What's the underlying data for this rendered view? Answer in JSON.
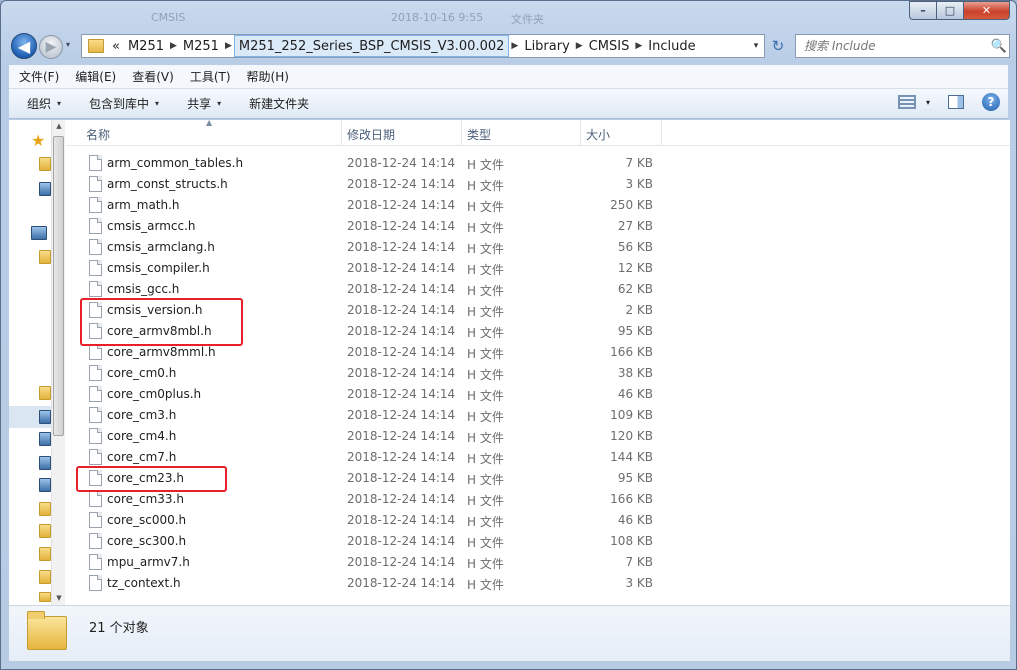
{
  "window": {
    "ghost_title_parts": [
      "CMSIS",
      "2018-10-16 9:55",
      "文件夹"
    ],
    "caption": {
      "minimize": "–",
      "maximize": "□",
      "close": "✕"
    }
  },
  "nav": {
    "back_glyph": "◀",
    "forward_glyph": "▶",
    "history_glyph": "▾"
  },
  "address": {
    "overflow": "«",
    "crumbs": [
      "M251",
      "M251",
      "M251_252_Series_BSP_CMSIS_V3.00.002",
      "Library",
      "CMSIS",
      "Include"
    ],
    "separator": "▶",
    "dropdown": "▾"
  },
  "refresh_glyph": "↻",
  "search": {
    "placeholder": "搜索 Include",
    "icon": "search-icon",
    "glyph": "🔍"
  },
  "menubar": {
    "items": [
      "文件(F)",
      "编辑(E)",
      "查看(V)",
      "工具(T)",
      "帮助(H)"
    ]
  },
  "cmdbar": {
    "organize": "组织",
    "include_library": "包含到库中",
    "share": "共享",
    "new_folder": "新建文件夹",
    "dropdown": "▾",
    "help": "?"
  },
  "columns": {
    "name": "名称",
    "date": "修改日期",
    "type": "类型",
    "size": "大小",
    "sort_indicator": "▲"
  },
  "files": [
    {
      "name": "arm_common_tables.h",
      "date": "2018-12-24 14:14",
      "type": "H 文件",
      "size": "7 KB"
    },
    {
      "name": "arm_const_structs.h",
      "date": "2018-12-24 14:14",
      "type": "H 文件",
      "size": "3 KB"
    },
    {
      "name": "arm_math.h",
      "date": "2018-12-24 14:14",
      "type": "H 文件",
      "size": "250 KB"
    },
    {
      "name": "cmsis_armcc.h",
      "date": "2018-12-24 14:14",
      "type": "H 文件",
      "size": "27 KB"
    },
    {
      "name": "cmsis_armclang.h",
      "date": "2018-12-24 14:14",
      "type": "H 文件",
      "size": "56 KB"
    },
    {
      "name": "cmsis_compiler.h",
      "date": "2018-12-24 14:14",
      "type": "H 文件",
      "size": "12 KB"
    },
    {
      "name": "cmsis_gcc.h",
      "date": "2018-12-24 14:14",
      "type": "H 文件",
      "size": "62 KB"
    },
    {
      "name": "cmsis_version.h",
      "date": "2018-12-24 14:14",
      "type": "H 文件",
      "size": "2 KB"
    },
    {
      "name": "core_armv8mbl.h",
      "date": "2018-12-24 14:14",
      "type": "H 文件",
      "size": "95 KB"
    },
    {
      "name": "core_armv8mml.h",
      "date": "2018-12-24 14:14",
      "type": "H 文件",
      "size": "166 KB"
    },
    {
      "name": "core_cm0.h",
      "date": "2018-12-24 14:14",
      "type": "H 文件",
      "size": "38 KB"
    },
    {
      "name": "core_cm0plus.h",
      "date": "2018-12-24 14:14",
      "type": "H 文件",
      "size": "46 KB"
    },
    {
      "name": "core_cm3.h",
      "date": "2018-12-24 14:14",
      "type": "H 文件",
      "size": "109 KB"
    },
    {
      "name": "core_cm4.h",
      "date": "2018-12-24 14:14",
      "type": "H 文件",
      "size": "120 KB"
    },
    {
      "name": "core_cm7.h",
      "date": "2018-12-24 14:14",
      "type": "H 文件",
      "size": "144 KB"
    },
    {
      "name": "core_cm23.h",
      "date": "2018-12-24 14:14",
      "type": "H 文件",
      "size": "95 KB"
    },
    {
      "name": "core_cm33.h",
      "date": "2018-12-24 14:14",
      "type": "H 文件",
      "size": "166 KB"
    },
    {
      "name": "core_sc000.h",
      "date": "2018-12-24 14:14",
      "type": "H 文件",
      "size": "46 KB"
    },
    {
      "name": "core_sc300.h",
      "date": "2018-12-24 14:14",
      "type": "H 文件",
      "size": "108 KB"
    },
    {
      "name": "mpu_armv7.h",
      "date": "2018-12-24 14:14",
      "type": "H 文件",
      "size": "7 KB"
    },
    {
      "name": "tz_context.h",
      "date": "2018-12-24 14:14",
      "type": "H 文件",
      "size": "3 KB"
    }
  ],
  "highlighted_files": [
    "cmsis_version.h",
    "core_armv8mbl.h",
    "core_cm23.h"
  ],
  "highlight_color": "#e8202a",
  "status": {
    "count_text": "21 个对象"
  },
  "navpane": {
    "favorite_glyph": "★",
    "scroll_up": "▲",
    "scroll_down": "▼"
  }
}
